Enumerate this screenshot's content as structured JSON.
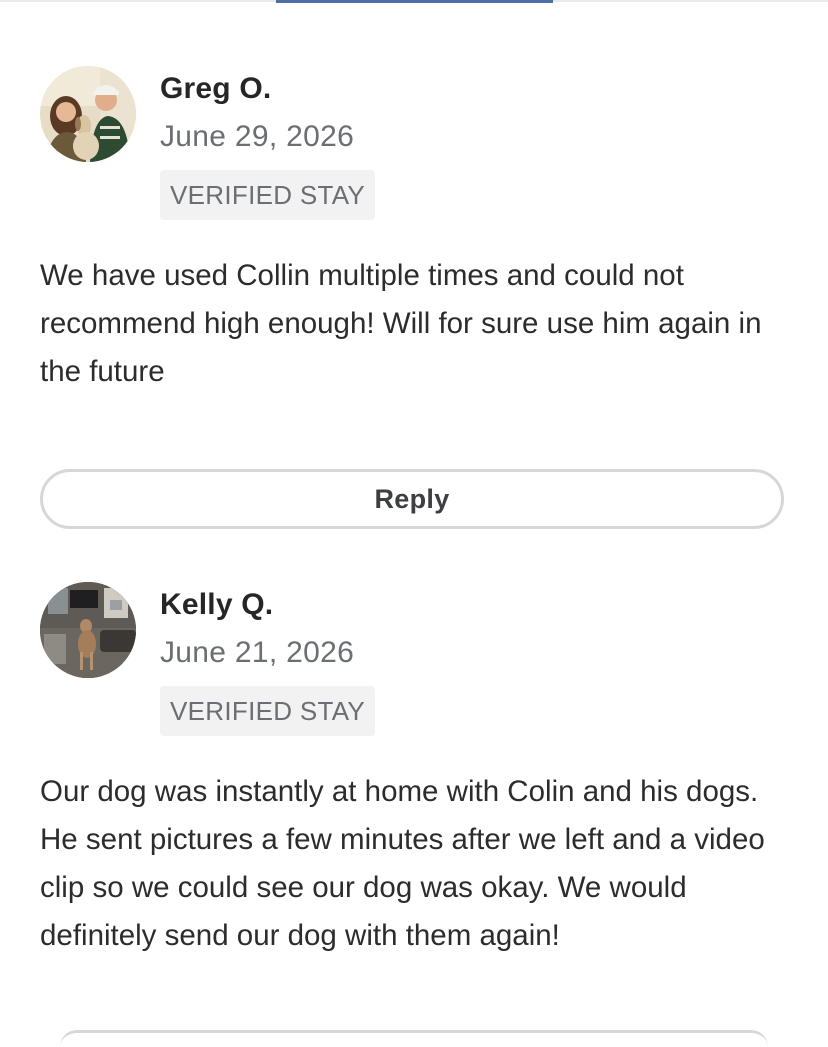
{
  "reviews": [
    {
      "avatar": "reviewer-photo-couple-with-dog",
      "name": "Greg O.",
      "date": "June 29, 2026",
      "badge": "VERIFIED STAY",
      "text": "We have used Collin multiple times and could not recommend high enough! Will for sure use him again in the future",
      "reply_label": "Reply"
    },
    {
      "avatar": "reviewer-photo-dog-in-living-room",
      "name": "Kelly Q.",
      "date": "June 21, 2026",
      "badge": "VERIFIED STAY",
      "text": "Our dog was instantly at home with Colin and his dogs. He sent pictures a few minutes after we left and a video clip so we could see our dog was okay. We would definitely send our dog with them again!"
    }
  ],
  "colors": {
    "accent": "#4d6fa6",
    "badge_bg": "#f2f2f3",
    "muted_text": "#6b6e72",
    "button_border": "#d6d7d9"
  }
}
